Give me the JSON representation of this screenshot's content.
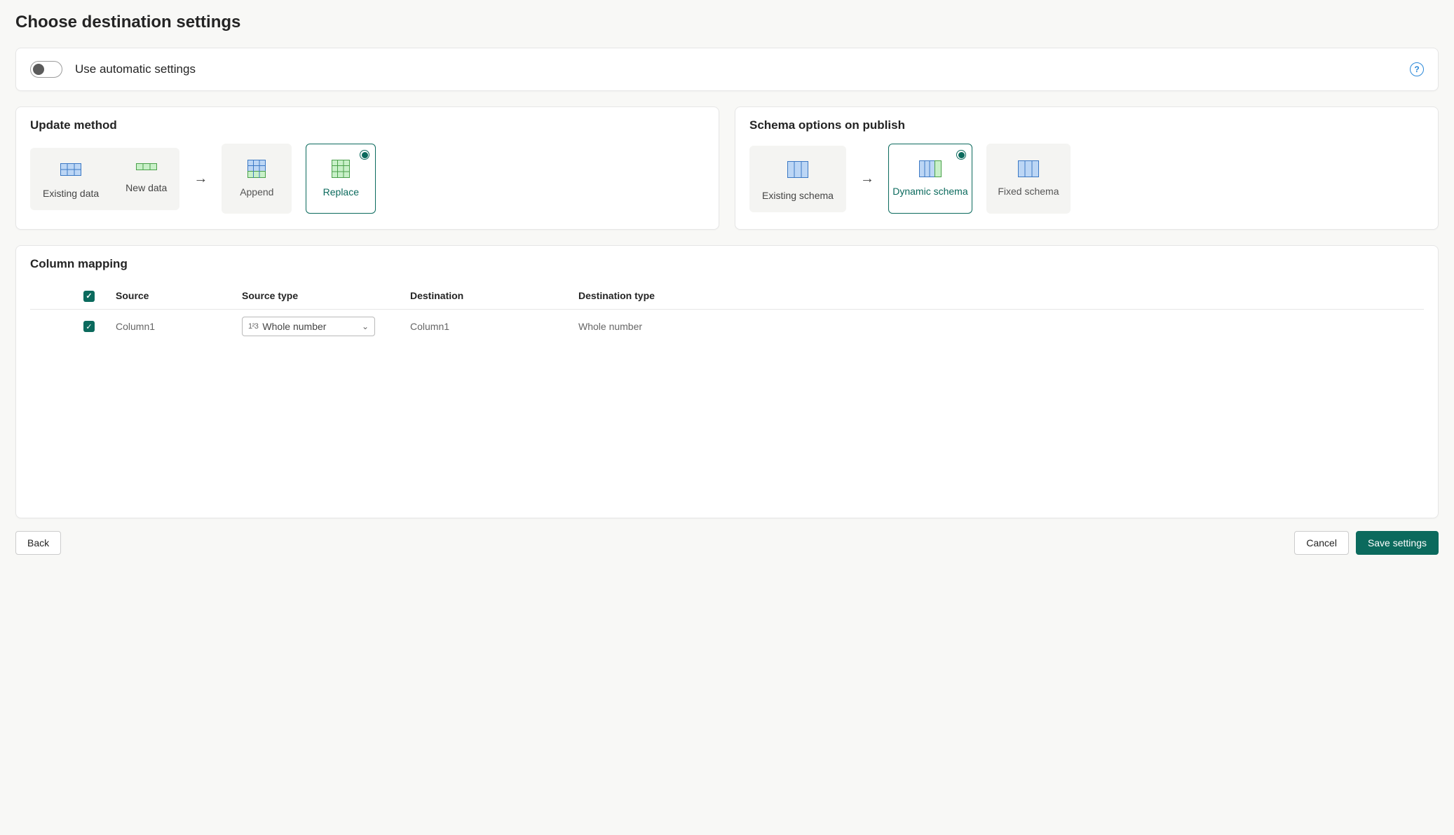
{
  "page": {
    "title": "Choose destination settings"
  },
  "autoSettings": {
    "label": "Use automatic settings",
    "enabled": false
  },
  "updateMethod": {
    "title": "Update method",
    "existingLabel": "Existing data",
    "newLabel": "New data",
    "options": [
      {
        "key": "append",
        "label": "Append",
        "selected": false
      },
      {
        "key": "replace",
        "label": "Replace",
        "selected": true
      }
    ]
  },
  "schemaOptions": {
    "title": "Schema options on publish",
    "existingLabel": "Existing schema",
    "options": [
      {
        "key": "dynamic",
        "label": "Dynamic schema",
        "selected": true
      },
      {
        "key": "fixed",
        "label": "Fixed schema",
        "selected": false
      }
    ]
  },
  "columnMapping": {
    "title": "Column mapping",
    "headers": {
      "source": "Source",
      "sourceType": "Source type",
      "destination": "Destination",
      "destinationType": "Destination type"
    },
    "rows": [
      {
        "checked": true,
        "source": "Column1",
        "sourceTypePrefix": "1²3",
        "sourceType": "Whole number",
        "destination": "Column1",
        "destinationType": "Whole number"
      }
    ]
  },
  "footer": {
    "back": "Back",
    "cancel": "Cancel",
    "save": "Save settings"
  }
}
